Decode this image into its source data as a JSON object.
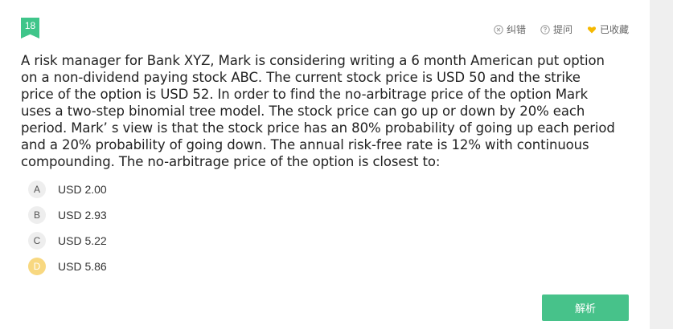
{
  "question": {
    "number": "18",
    "text": "A risk manager for Bank XYZ, Mark is considering writing a 6 month American put option on a non-dividend paying stock ABC. The current stock price is USD 50 and the strike price of the option is USD 52. In order to find the no-arbitrage price of the option Mark uses a two-step binomial tree model. The stock price can go up or down by 20% each period. Mark’ s view is that the stock price has an 80% probability of going up each period and a 20% probability of going down. The annual risk-free rate is 12% with continuous compounding. The no-arbitrage price of the option is closest to:"
  },
  "actions": {
    "report_error": "纠错",
    "ask": "提问",
    "favorited": "已收藏"
  },
  "options": [
    {
      "letter": "A",
      "text": "USD 2.00",
      "selected": false
    },
    {
      "letter": "B",
      "text": "USD 2.93",
      "selected": false
    },
    {
      "letter": "C",
      "text": "USD 5.22",
      "selected": false
    },
    {
      "letter": "D",
      "text": "USD 5.86",
      "selected": true
    }
  ],
  "analysis_button": "解析",
  "colors": {
    "accent": "#47c28a",
    "badge": "#3fc58a",
    "selected_option": "#f8d880",
    "heart": "#f5b800"
  },
  "icons": {
    "report_error": "close-circle-icon",
    "ask": "question-circle-icon",
    "favorited": "heart-icon"
  }
}
